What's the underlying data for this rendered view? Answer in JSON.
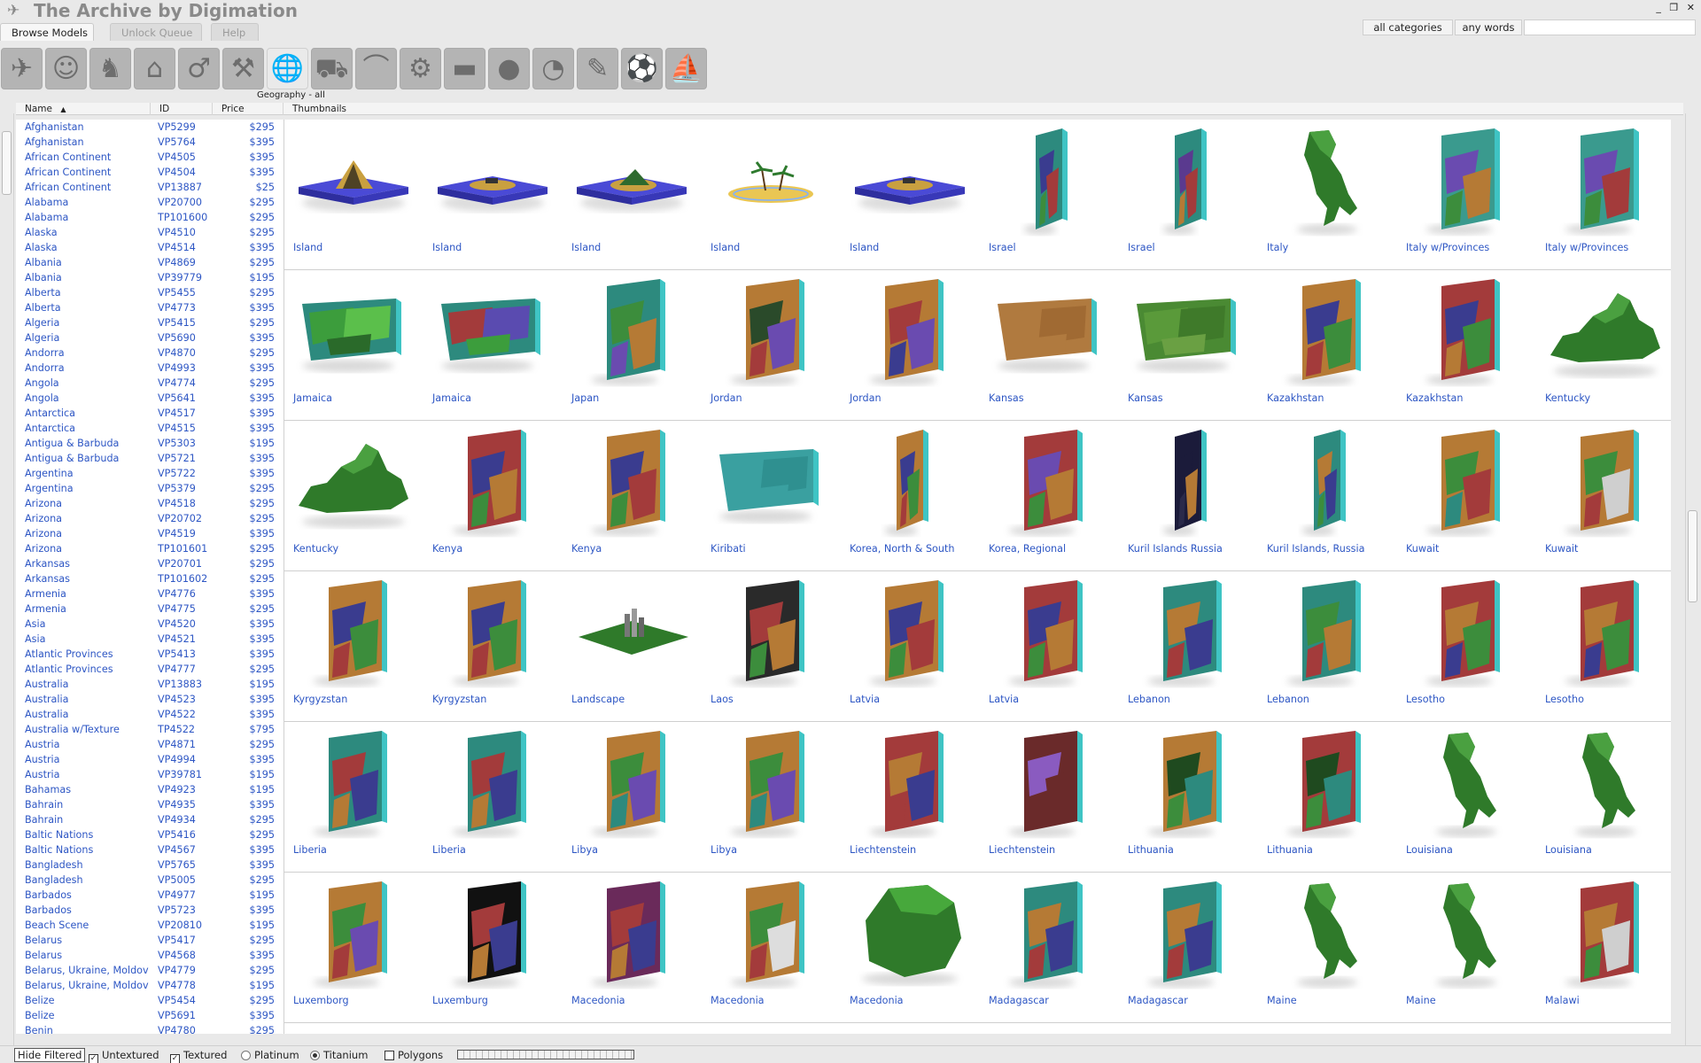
{
  "app": {
    "title": "The Archive by Digimation",
    "window_controls": "_ ❐ ✕"
  },
  "tabs": [
    {
      "label": "Browse Models",
      "active": true
    },
    {
      "label": "Unlock Queue",
      "active": false
    },
    {
      "label": "Help",
      "active": false
    }
  ],
  "search": {
    "category": "all categories",
    "mode": "any words",
    "value": ""
  },
  "categories": [
    {
      "icon": "airplane-icon",
      "glyph": "✈"
    },
    {
      "icon": "head-icon",
      "glyph": "☺"
    },
    {
      "icon": "horse-icon",
      "glyph": "♞"
    },
    {
      "icon": "building-icon",
      "glyph": "⌂"
    },
    {
      "icon": "runner-icon",
      "glyph": "♂"
    },
    {
      "icon": "tractor-icon",
      "glyph": "⚒"
    },
    {
      "icon": "globe-icon",
      "glyph": "🌐",
      "active": true
    },
    {
      "icon": "car-icon",
      "glyph": "⛟"
    },
    {
      "icon": "hanger-icon",
      "glyph": "⌒"
    },
    {
      "icon": "gear-icon",
      "glyph": "⚙"
    },
    {
      "icon": "tank-icon",
      "glyph": "▬"
    },
    {
      "icon": "apple-icon",
      "glyph": "●"
    },
    {
      "icon": "abstract-icon",
      "glyph": "◔"
    },
    {
      "icon": "tools-icon",
      "glyph": "✎"
    },
    {
      "icon": "soccer-ball-icon",
      "glyph": "⚽"
    },
    {
      "icon": "sailboat-icon",
      "glyph": "⛵"
    }
  ],
  "active_category_label": "Geography - all",
  "columns": {
    "name": "Name",
    "sort": "▲",
    "id": "ID",
    "price": "Price",
    "thumbnails": "Thumbnails"
  },
  "list": [
    {
      "name": "Afghanistan",
      "id": "VP5299",
      "price": "$295"
    },
    {
      "name": "Afghanistan",
      "id": "VP5764",
      "price": "$395"
    },
    {
      "name": "African Continent",
      "id": "VP4505",
      "price": "$395"
    },
    {
      "name": "African Continent",
      "id": "VP4504",
      "price": "$395"
    },
    {
      "name": "African Continent",
      "id": "VP13887",
      "price": "$25"
    },
    {
      "name": "Alabama",
      "id": "VP20700",
      "price": "$295"
    },
    {
      "name": "Alabama",
      "id": "TP101600",
      "price": "$295"
    },
    {
      "name": "Alaska",
      "id": "VP4510",
      "price": "$295"
    },
    {
      "name": "Alaska",
      "id": "VP4514",
      "price": "$395"
    },
    {
      "name": "Albania",
      "id": "VP4869",
      "price": "$295"
    },
    {
      "name": "Albania",
      "id": "VP39779",
      "price": "$195"
    },
    {
      "name": "Alberta",
      "id": "VP5455",
      "price": "$295"
    },
    {
      "name": "Alberta",
      "id": "VP4773",
      "price": "$395"
    },
    {
      "name": "Algeria",
      "id": "VP5415",
      "price": "$295"
    },
    {
      "name": "Algeria",
      "id": "VP5690",
      "price": "$395"
    },
    {
      "name": "Andorra",
      "id": "VP4870",
      "price": "$295"
    },
    {
      "name": "Andorra",
      "id": "VP4993",
      "price": "$395"
    },
    {
      "name": "Angola",
      "id": "VP4774",
      "price": "$295"
    },
    {
      "name": "Angola",
      "id": "VP5641",
      "price": "$395"
    },
    {
      "name": "Antarctica",
      "id": "VP4517",
      "price": "$395"
    },
    {
      "name": "Antarctica",
      "id": "VP4515",
      "price": "$395"
    },
    {
      "name": "Antigua & Barbuda",
      "id": "VP5303",
      "price": "$195"
    },
    {
      "name": "Antigua & Barbuda",
      "id": "VP5721",
      "price": "$395"
    },
    {
      "name": "Argentina",
      "id": "VP5722",
      "price": "$395"
    },
    {
      "name": "Argentina",
      "id": "VP5379",
      "price": "$295"
    },
    {
      "name": "Arizona",
      "id": "VP4518",
      "price": "$295"
    },
    {
      "name": "Arizona",
      "id": "VP20702",
      "price": "$295"
    },
    {
      "name": "Arizona",
      "id": "VP4519",
      "price": "$395"
    },
    {
      "name": "Arizona",
      "id": "TP101601",
      "price": "$295"
    },
    {
      "name": "Arkansas",
      "id": "VP20701",
      "price": "$295"
    },
    {
      "name": "Arkansas",
      "id": "TP101602",
      "price": "$295"
    },
    {
      "name": "Armenia",
      "id": "VP4776",
      "price": "$395"
    },
    {
      "name": "Armenia",
      "id": "VP4775",
      "price": "$295"
    },
    {
      "name": "Asia",
      "id": "VP4520",
      "price": "$395"
    },
    {
      "name": "Asia",
      "id": "VP4521",
      "price": "$395"
    },
    {
      "name": "Atlantic Provinces",
      "id": "VP5413",
      "price": "$395"
    },
    {
      "name": "Atlantic Provinces",
      "id": "VP4777",
      "price": "$295"
    },
    {
      "name": "Australia",
      "id": "VP13883",
      "price": "$195"
    },
    {
      "name": "Australia",
      "id": "VP4523",
      "price": "$395"
    },
    {
      "name": "Australia",
      "id": "VP4522",
      "price": "$395"
    },
    {
      "name": "Australia w/Texture",
      "id": "TP4522",
      "price": "$795"
    },
    {
      "name": "Austria",
      "id": "VP4871",
      "price": "$295"
    },
    {
      "name": "Austria",
      "id": "VP4994",
      "price": "$395"
    },
    {
      "name": "Austria",
      "id": "VP39781",
      "price": "$195"
    },
    {
      "name": "Bahamas",
      "id": "VP4923",
      "price": "$195"
    },
    {
      "name": "Bahrain",
      "id": "VP4935",
      "price": "$395"
    },
    {
      "name": "Bahrain",
      "id": "VP4934",
      "price": "$295"
    },
    {
      "name": "Baltic Nations",
      "id": "VP5416",
      "price": "$295"
    },
    {
      "name": "Baltic Nations",
      "id": "VP4567",
      "price": "$395"
    },
    {
      "name": "Bangladesh",
      "id": "VP5765",
      "price": "$395"
    },
    {
      "name": "Bangladesh",
      "id": "VP5005",
      "price": "$295"
    },
    {
      "name": "Barbados",
      "id": "VP4977",
      "price": "$195"
    },
    {
      "name": "Barbados",
      "id": "VP5723",
      "price": "$395"
    },
    {
      "name": "Beach Scene",
      "id": "VP20810",
      "price": "$195"
    },
    {
      "name": "Belarus",
      "id": "VP5417",
      "price": "$295"
    },
    {
      "name": "Belarus",
      "id": "VP4568",
      "price": "$395"
    },
    {
      "name": "Belarus, Ukraine, Moldov",
      "id": "VP4779",
      "price": "$295"
    },
    {
      "name": "Belarus, Ukraine, Moldov",
      "id": "VP4778",
      "price": "$195"
    },
    {
      "name": "Belize",
      "id": "VP5454",
      "price": "$295"
    },
    {
      "name": "Belize",
      "id": "VP5691",
      "price": "$395"
    },
    {
      "name": "Benin",
      "id": "VP4780",
      "price": "$295"
    }
  ],
  "thumbnail_rows": [
    [
      {
        "label": "Island",
        "kind": "island-volcano"
      },
      {
        "label": "Island",
        "kind": "island-flat"
      },
      {
        "label": "Island",
        "kind": "island-hill"
      },
      {
        "label": "Island",
        "kind": "island-palm"
      },
      {
        "label": "Island",
        "kind": "island-flat"
      },
      {
        "label": "Israel",
        "kind": "slab-tall",
        "colors": [
          "#2d8a7e",
          "#3a3c8f",
          "#a33b3b",
          "#3c8d3c"
        ]
      },
      {
        "label": "Israel",
        "kind": "slab-tall",
        "colors": [
          "#2d8a7e",
          "#5a3a8f",
          "#a33b3b",
          "#b57a35"
        ]
      },
      {
        "label": "Italy",
        "kind": "shape-green"
      },
      {
        "label": "Italy w/Provinces",
        "kind": "slab",
        "colors": [
          "#3a9a8e",
          "#6a4bb0",
          "#b57a35",
          "#3c8d3c"
        ]
      },
      {
        "label": "Italy w/Provinces",
        "kind": "slab",
        "colors": [
          "#3a9a8e",
          "#6a4bb0",
          "#a33b3b",
          "#3c8d3c"
        ]
      }
    ],
    [
      {
        "label": "Jamaica",
        "kind": "slab-wide",
        "colors": [
          "#2d8a7e",
          "#3c9d3c",
          "#5bbf4b",
          "#2a6a2a"
        ]
      },
      {
        "label": "Jamaica",
        "kind": "slab-wide",
        "colors": [
          "#2d8a7e",
          "#a33b3b",
          "#5a4bb0",
          "#3c9d3c"
        ]
      },
      {
        "label": "Japan",
        "kind": "slab",
        "colors": [
          "#2d8a7e",
          "#3c8d3c",
          "#b57a35",
          "#6a4bb0"
        ]
      },
      {
        "label": "Jordan",
        "kind": "slab",
        "colors": [
          "#b57a35",
          "#2a4a2a",
          "#6a4bb0",
          "#a33b3b"
        ]
      },
      {
        "label": "Jordan",
        "kind": "slab",
        "colors": [
          "#b57a35",
          "#a33b3b",
          "#6a4bb0",
          "#3a3c8f"
        ]
      },
      {
        "label": "Kansas",
        "kind": "slab-wide",
        "colors": [
          "#b07a3f",
          "#b07a3f",
          "#a06a33",
          "#b07a3f"
        ]
      },
      {
        "label": "Kansas",
        "kind": "slab-wide",
        "colors": [
          "#4a8a33",
          "#5a9a3a",
          "#3f7a2a",
          "#6aa043"
        ]
      },
      {
        "label": "Kazakhstan",
        "kind": "slab",
        "colors": [
          "#b57a35",
          "#3a3c8f",
          "#3c8d3c",
          "#a33b3b"
        ]
      },
      {
        "label": "Kazakhstan",
        "kind": "slab",
        "colors": [
          "#a33b3b",
          "#3a3c8f",
          "#3c8d3c",
          "#b57a35"
        ]
      },
      {
        "label": "Kentucky",
        "kind": "shape-green-wide"
      }
    ],
    [
      {
        "label": "Kentucky",
        "kind": "shape-green-wide"
      },
      {
        "label": "Kenya",
        "kind": "slab",
        "colors": [
          "#a33b3b",
          "#3a3c8f",
          "#b57a35",
          "#3c8d3c"
        ]
      },
      {
        "label": "Kenya",
        "kind": "slab",
        "colors": [
          "#b57a35",
          "#3a3c8f",
          "#a33b3b",
          "#3c8d3c"
        ]
      },
      {
        "label": "Kiribati",
        "kind": "slab-wide",
        "colors": [
          "#3aa0a0",
          "#3aa0a0",
          "#2f9090",
          "#3aa0a0"
        ]
      },
      {
        "label": "Korea, North & South",
        "kind": "slab-tall",
        "colors": [
          "#b57a35",
          "#3a3c8f",
          "#3c8d3c",
          "#a33b3b"
        ]
      },
      {
        "label": "Korea, Regional",
        "kind": "slab",
        "colors": [
          "#a33b3b",
          "#6a4bb0",
          "#b57a35",
          "#3c8d3c"
        ]
      },
      {
        "label": "Kuril Islands Russia",
        "kind": "slab-tall",
        "colors": [
          "#1b1b3a",
          "#1b1b3a",
          "#b57a35",
          "#2a2a4a"
        ]
      },
      {
        "label": "Kuril Islands, Russia",
        "kind": "slab-tall",
        "colors": [
          "#2d8a7e",
          "#b57a35",
          "#3a3c8f",
          "#3c8d3c"
        ]
      },
      {
        "label": "Kuwait",
        "kind": "slab",
        "colors": [
          "#b57a35",
          "#3c8d3c",
          "#a33b3b",
          "#2d8a7e"
        ]
      },
      {
        "label": "Kuwait",
        "kind": "slab",
        "colors": [
          "#b57a35",
          "#3c8d3c",
          "#cfcfcf",
          "#a33b3b"
        ]
      }
    ],
    [
      {
        "label": "Kyrgyzstan",
        "kind": "slab",
        "colors": [
          "#b57a35",
          "#3a3c8f",
          "#3c8d3c",
          "#a33b3b"
        ]
      },
      {
        "label": "Kyrgyzstan",
        "kind": "slab",
        "colors": [
          "#b57a35",
          "#3a3c8f",
          "#3c8d3c",
          "#a33b3b"
        ]
      },
      {
        "label": "Landscape",
        "kind": "landscape"
      },
      {
        "label": "Laos",
        "kind": "slab",
        "colors": [
          "#2a2a2a",
          "#a33b3b",
          "#b57a35",
          "#3c8d3c"
        ]
      },
      {
        "label": "Latvia",
        "kind": "slab",
        "colors": [
          "#b57a35",
          "#3a3c8f",
          "#a33b3b",
          "#3c8d3c"
        ]
      },
      {
        "label": "Latvia",
        "kind": "slab",
        "colors": [
          "#a33b3b",
          "#3a3c8f",
          "#b57a35",
          "#3c8d3c"
        ]
      },
      {
        "label": "Lebanon",
        "kind": "slab",
        "colors": [
          "#2d8a7e",
          "#b57a35",
          "#3a3c8f",
          "#a33b3b"
        ]
      },
      {
        "label": "Lebanon",
        "kind": "slab",
        "colors": [
          "#2d8a7e",
          "#3c8d3c",
          "#b57a35",
          "#a33b3b"
        ]
      },
      {
        "label": "Lesotho",
        "kind": "slab",
        "colors": [
          "#a33b3b",
          "#b57a35",
          "#3c8d3c",
          "#3a3c8f"
        ]
      },
      {
        "label": "Lesotho",
        "kind": "slab",
        "colors": [
          "#a33b3b",
          "#b57a35",
          "#3c8d3c",
          "#3a3c8f"
        ]
      }
    ],
    [
      {
        "label": "Liberia",
        "kind": "slab",
        "colors": [
          "#2d8a7e",
          "#a33b3b",
          "#3a3c8f",
          "#b57a35"
        ]
      },
      {
        "label": "Liberia",
        "kind": "slab",
        "colors": [
          "#2d8a7e",
          "#a33b3b",
          "#3a3c8f",
          "#b57a35"
        ]
      },
      {
        "label": "Libya",
        "kind": "slab",
        "colors": [
          "#b57a35",
          "#3c8d3c",
          "#6a4bb0",
          "#2d8a7e"
        ]
      },
      {
        "label": "Libya",
        "kind": "slab",
        "colors": [
          "#b57a35",
          "#3c8d3c",
          "#6a4bb0",
          "#2d8a7e"
        ]
      },
      {
        "label": "Liechtenstein",
        "kind": "slab",
        "colors": [
          "#a33b3b",
          "#b57a35",
          "#3a3c8f",
          "#a33b3b"
        ]
      },
      {
        "label": "Liechtenstein",
        "kind": "slab",
        "colors": [
          "#6a2a2a",
          "#8a5bc0",
          "#6a2a2a",
          "#6a2a2a"
        ]
      },
      {
        "label": "Lithuania",
        "kind": "slab",
        "colors": [
          "#b57a35",
          "#1f4a1f",
          "#2d8a7e",
          "#3c8d3c"
        ]
      },
      {
        "label": "Lithuania",
        "kind": "slab",
        "colors": [
          "#a33b3b",
          "#1f4a1f",
          "#2d8a7e",
          "#3c8d3c"
        ]
      },
      {
        "label": "Louisiana",
        "kind": "shape-green"
      },
      {
        "label": "Louisiana",
        "kind": "shape-green"
      }
    ],
    [
      {
        "label": "Luxemborg",
        "kind": "slab",
        "colors": [
          "#b57a35",
          "#3c8d3c",
          "#6a4bb0",
          "#a33b3b"
        ]
      },
      {
        "label": "Luxemburg",
        "kind": "slab",
        "colors": [
          "#111111",
          "#a33b3b",
          "#3a3c8f",
          "#b57a35"
        ]
      },
      {
        "label": "Macedonia",
        "kind": "slab",
        "colors": [
          "#6a2a5a",
          "#a33b3b",
          "#3a3c8f",
          "#b57a35"
        ]
      },
      {
        "label": "Macedonia",
        "kind": "slab",
        "colors": [
          "#b57a35",
          "#3c8d3c",
          "#dddddd",
          "#a33b3b"
        ]
      },
      {
        "label": "Macedonia",
        "kind": "shape-green-round"
      },
      {
        "label": "Madagascar",
        "kind": "slab",
        "colors": [
          "#2d8a7e",
          "#b57a35",
          "#3a3c8f",
          "#a33b3b"
        ]
      },
      {
        "label": "Madagascar",
        "kind": "slab",
        "colors": [
          "#2d8a7e",
          "#b57a35",
          "#3a3c8f",
          "#a33b3b"
        ]
      },
      {
        "label": "Maine",
        "kind": "shape-green"
      },
      {
        "label": "Maine",
        "kind": "shape-green"
      },
      {
        "label": "Malawi",
        "kind": "slab",
        "colors": [
          "#a33b3b",
          "#b57a35",
          "#cfcfcf",
          "#3c8d3c"
        ]
      }
    ]
  ],
  "bottom": {
    "hide_filtered": "Hide Filtered",
    "untextured": {
      "label": "Untextured",
      "checked": true
    },
    "textured": {
      "label": "Textured",
      "checked": true
    },
    "platinum": {
      "label": "Platinum",
      "selected": false
    },
    "titanium": {
      "label": "Titanium",
      "selected": true
    },
    "polygons": {
      "label": "Polygons",
      "checked": false
    }
  }
}
